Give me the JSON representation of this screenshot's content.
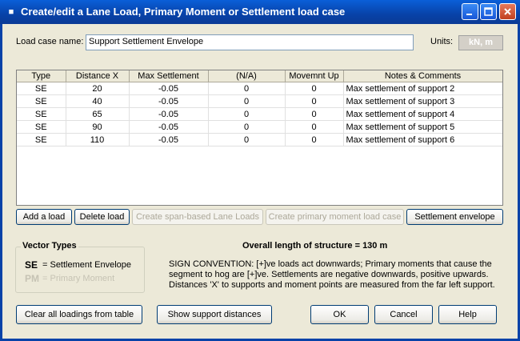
{
  "window": {
    "title": "Create/edit a Lane Load, Primary Moment or Settlement load case"
  },
  "load_case": {
    "label": "Load case name:",
    "value": "Support Settlement Envelope"
  },
  "units": {
    "label": "Units:",
    "value": "kN, m"
  },
  "table": {
    "headers": [
      "Type",
      "Distance X",
      "Max Settlement",
      "(N/A)",
      "Movemnt Up",
      "Notes & Comments"
    ],
    "rows": [
      [
        "SE",
        "20",
        "-0.05",
        "0",
        "0",
        "Max settlement of support 2"
      ],
      [
        "SE",
        "40",
        "-0.05",
        "0",
        "0",
        "Max settlement of support 3"
      ],
      [
        "SE",
        "65",
        "-0.05",
        "0",
        "0",
        "Max settlement of support 4"
      ],
      [
        "SE",
        "90",
        "-0.05",
        "0",
        "0",
        "Max settlement of support 5"
      ],
      [
        "SE",
        "110",
        "-0.05",
        "0",
        "0",
        "Max settlement of support 6"
      ]
    ]
  },
  "buttons": {
    "add_load": "Add a load",
    "delete_load": "Delete load",
    "create_span_lane": "Create span-based Lane Loads",
    "create_primary_moment": "Create primary moment load case",
    "settlement_envelope": "Settlement envelope",
    "clear_all": "Clear all loadings from table",
    "show_support": "Show support distances",
    "ok": "OK",
    "cancel": "Cancel",
    "help": "Help"
  },
  "vector_types": {
    "title": "Vector Types",
    "se_code": "SE",
    "se_text": "= Settlement Envelope",
    "pm_code": "PM",
    "pm_text": "= Primary Moment"
  },
  "info": {
    "overall_length": "Overall length of structure = 130 m",
    "sign_line1": "SIGN CONVENTION:  [+]ve loads act downwards;  Primary moments that cause the",
    "sign_line2": "segment to hog are [+]ve.  Settlements are negative downwards, positive upwards.",
    "sign_line3": "Distances 'X' to supports and moment points are measured from the far left support."
  }
}
